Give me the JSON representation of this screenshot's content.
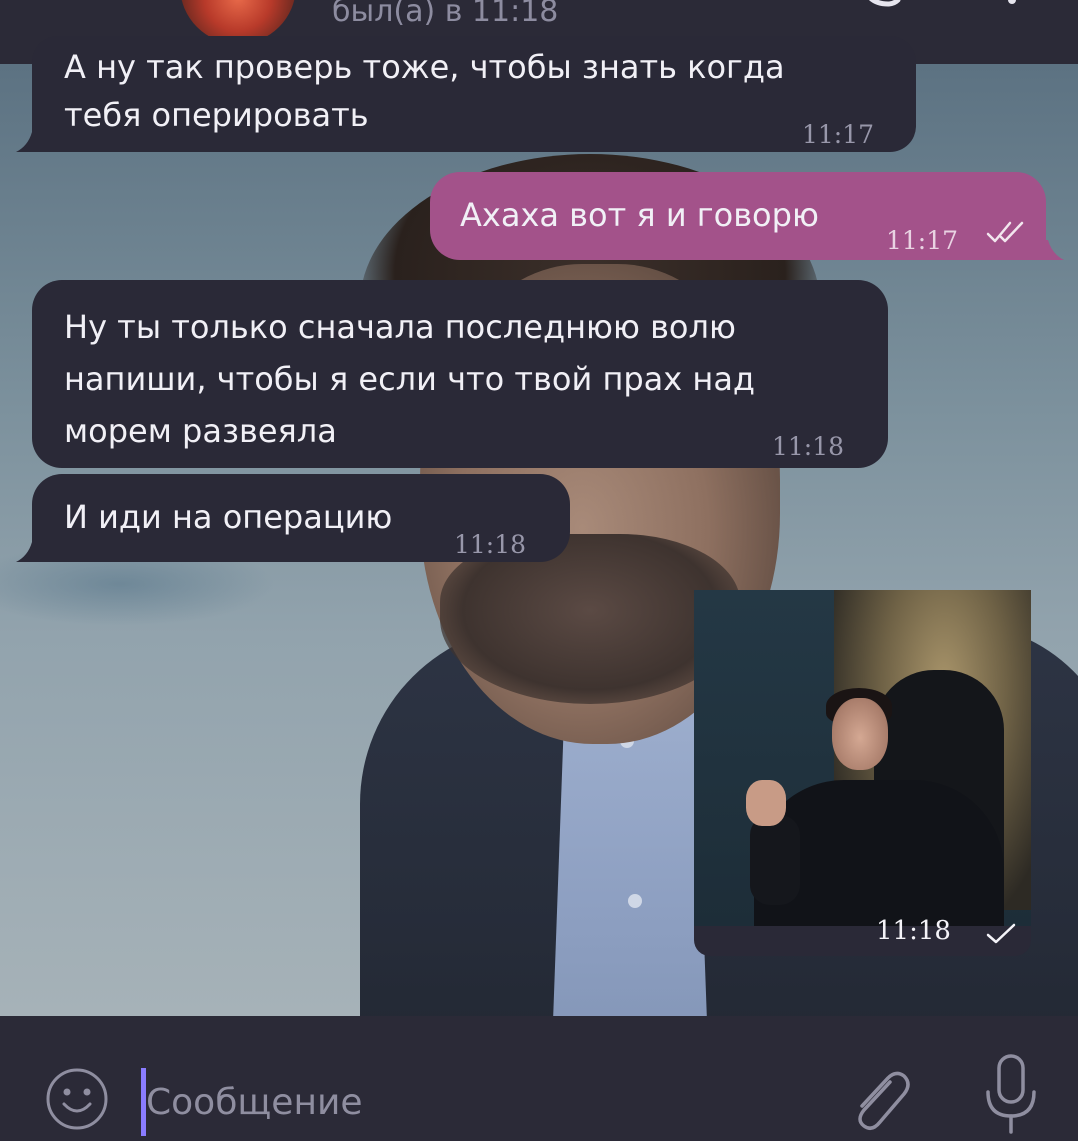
{
  "header": {
    "status": "был(а) в 11:18"
  },
  "messages": [
    {
      "direction": "incoming",
      "lines": [
        "А ну так проверь тоже, чтобы знать когда",
        "тебя оперировать"
      ],
      "time": "11:17"
    },
    {
      "direction": "outgoing",
      "lines": [
        "Ахаха вот я и говорю"
      ],
      "time": "11:17",
      "status": "read"
    },
    {
      "direction": "incoming",
      "lines": [
        "Ну ты только сначала последнюю волю",
        "напиши, чтобы я если что твой прах над",
        "морем развеяла"
      ],
      "time": "11:18"
    },
    {
      "direction": "incoming",
      "lines": [
        "И иди на операцию"
      ],
      "time": "11:18"
    },
    {
      "direction": "outgoing",
      "type": "image",
      "time": "11:18",
      "status": "sent"
    }
  ],
  "input": {
    "placeholder": "Сообщение"
  },
  "colors": {
    "background": "#2b2a37",
    "incoming_bubble": "#2a2937",
    "outgoing_bubble": "#a3528a",
    "time_text": "#9897aa",
    "caret": "#8a7cff"
  },
  "icons": {
    "emoji": "emoji-icon",
    "attach": "paperclip-icon",
    "mic": "microphone-icon",
    "read": "double-check-icon",
    "sent": "check-icon"
  }
}
